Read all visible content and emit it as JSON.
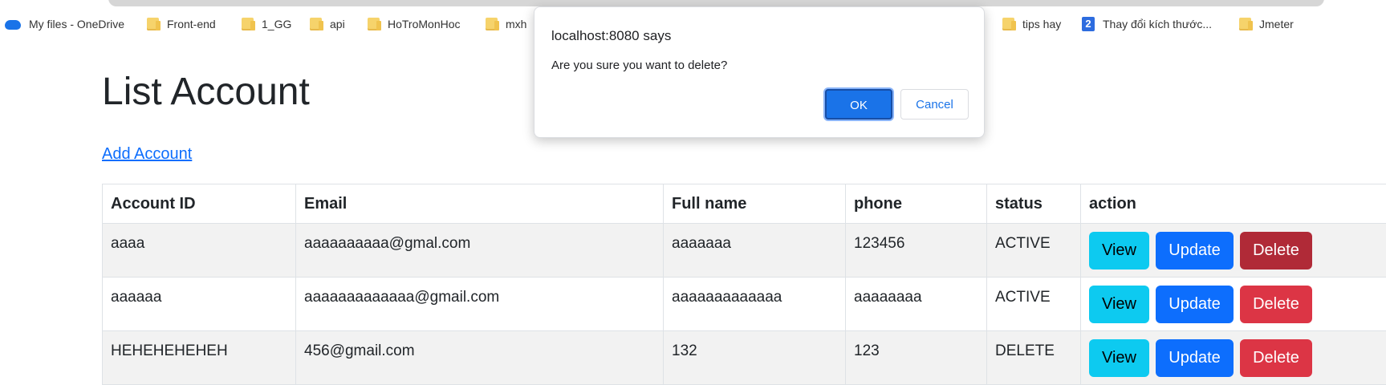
{
  "bookmarks": [
    {
      "label": "My files - OneDrive",
      "icon": "onedrive-cloud-icon"
    },
    {
      "label": "Front-end",
      "icon": "folder-icon"
    },
    {
      "label": "1_GG",
      "icon": "folder-icon"
    },
    {
      "label": "api",
      "icon": "folder-icon"
    },
    {
      "label": "HoTroMonHoc",
      "icon": "folder-icon"
    },
    {
      "label": "mxh",
      "icon": "folder-icon"
    },
    {
      "label": "tips hay",
      "icon": "folder-icon"
    },
    {
      "label": "Thay đổi kích thước...",
      "icon": "number-2-site-icon"
    },
    {
      "label": "Jmeter",
      "icon": "folder-icon"
    }
  ],
  "page": {
    "title": "List Account",
    "add_link": "Add Account"
  },
  "table": {
    "headers": [
      "Account ID",
      "Email",
      "Full name",
      "phone",
      "status",
      "action"
    ],
    "rows": [
      {
        "id": "aaaa",
        "email": "aaaaaaaaaa@gmal.com",
        "full_name": "aaaaaaa",
        "phone": "123456",
        "status": "ACTIVE"
      },
      {
        "id": "aaaaaa",
        "email": "aaaaaaaaaaaaa@gmail.com",
        "full_name": "aaaaaaaaaaaaa",
        "phone": "aaaaaaaa",
        "status": "ACTIVE"
      },
      {
        "id": "HEHEHEHEHEH",
        "email": "456@gmail.com",
        "full_name": "132",
        "phone": "123",
        "status": "DELETE"
      }
    ],
    "actions": {
      "view": "View",
      "update": "Update",
      "delete": "Delete"
    }
  },
  "dialog": {
    "origin": "localhost:8080 says",
    "message": "Are you sure you want to delete?",
    "ok_label": "OK",
    "cancel_label": "Cancel"
  },
  "colors": {
    "view_button": "#0dcaf0",
    "update_button": "#0d6efd",
    "delete_button": "#dc3545",
    "dialog_primary": "#1a73e8"
  }
}
